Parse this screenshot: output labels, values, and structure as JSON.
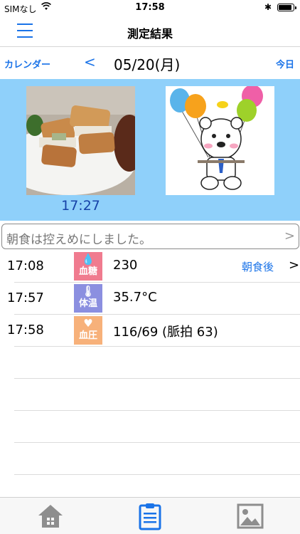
{
  "status_bar": {
    "carrier": "SIMなし",
    "time": "17:58"
  },
  "nav": {
    "title": "測定結果"
  },
  "date_bar": {
    "calendar_label": "カレンダー",
    "prev": "<",
    "date": "05/20(月)",
    "today_label": "今日"
  },
  "photos": {
    "time": "17:27"
  },
  "memo": {
    "text": "朝食は控えめにしました。",
    "arrow": ">"
  },
  "records": [
    {
      "time": "17:08",
      "badge_label": "血糖",
      "badge_color": "#f07b8f",
      "value": "230",
      "tag": "朝食後",
      "arrow": ">"
    },
    {
      "time": "17:57",
      "badge_label": "体温",
      "badge_color": "#8b8fe0",
      "value": "35.7°C",
      "tag": "",
      "arrow": ""
    },
    {
      "time": "17:58",
      "badge_label": "血圧",
      "badge_color": "#f7b17a",
      "value": "116/69 (脈拍 63)",
      "tag": "",
      "arrow": ""
    }
  ],
  "colors": {
    "accent": "#1a73e8",
    "photo_bg": "#8fd0fa",
    "tab_active": "#1a73e8",
    "tab_inactive": "#8e8e8e"
  },
  "icons": [
    "menu-icon",
    "wifi-icon",
    "bluetooth-icon",
    "battery-icon",
    "home-icon",
    "clipboard-icon",
    "image-icon"
  ]
}
